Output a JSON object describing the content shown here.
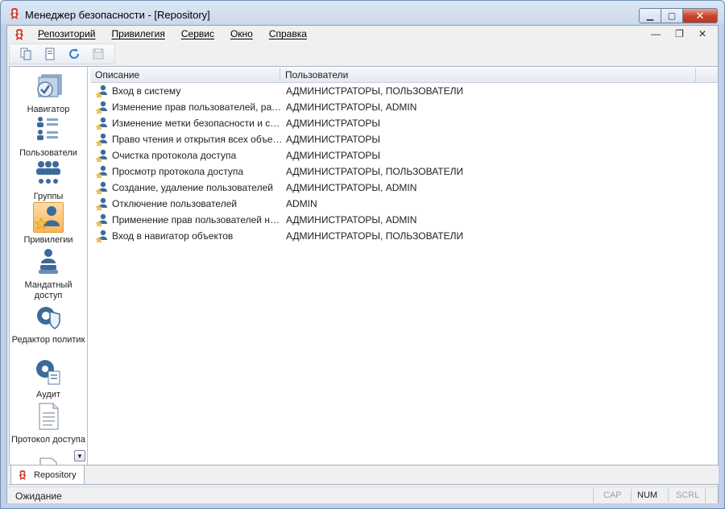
{
  "window": {
    "title": "Менеджер безопасности - [Repository]",
    "buttons": {
      "minimize": "▁",
      "maximize": "▢",
      "close": "✕"
    }
  },
  "menu": {
    "items": [
      "Репозиторий",
      "Привилегия",
      "Сервис",
      "Окно",
      "Справка"
    ],
    "mdi": {
      "minimize": "—",
      "restore": "❐",
      "close": "✕"
    }
  },
  "toolbar": {
    "buttons": [
      "copy-icon",
      "document-icon",
      "refresh-icon",
      "save-icon"
    ]
  },
  "nav": {
    "items": [
      {
        "label": "Навигатор",
        "icon": "navigator-icon",
        "active": false
      },
      {
        "label": "Пользователи",
        "icon": "users-list-icon",
        "active": false
      },
      {
        "label": "Группы",
        "icon": "groups-icon",
        "active": false
      },
      {
        "label": "Привилегии",
        "icon": "privileges-icon",
        "active": true
      },
      {
        "label": "Мандатный доступ",
        "icon": "mandatory-access-icon",
        "active": false
      },
      {
        "label": "Редактор политик",
        "icon": "policy-editor-icon",
        "active": false
      },
      {
        "label": "Аудит",
        "icon": "audit-icon",
        "active": false
      },
      {
        "label": "Протокол доступа",
        "icon": "access-log-icon",
        "active": false
      }
    ],
    "scroll_glyph": "▼"
  },
  "grid": {
    "columns": [
      "Описание",
      "Пользователи"
    ],
    "rows": [
      {
        "desc": "Вход в систему",
        "users": "АДМИНИСТРАТОРЫ, ПОЛЬЗОВАТЕЛИ"
      },
      {
        "desc": "Изменение прав пользователей, разд...",
        "users": "АДМИНИСТРАТОРЫ, ADMIN"
      },
      {
        "desc": "Изменение метки безопасности и спис...",
        "users": "АДМИНИСТРАТОРЫ"
      },
      {
        "desc": "Право чтения и открытия всех объек...",
        "users": "АДМИНИСТРАТОРЫ"
      },
      {
        "desc": "Очистка протокола доступа",
        "users": "АДМИНИСТРАТОРЫ"
      },
      {
        "desc": "Просмотр протокола доступа",
        "users": "АДМИНИСТРАТОРЫ, ПОЛЬЗОВАТЕЛИ"
      },
      {
        "desc": "Создание, удаление пользователей",
        "users": "АДМИНИСТРАТОРЫ, ADMIN"
      },
      {
        "desc": "Отключение пользователей",
        "users": "ADMIN"
      },
      {
        "desc": "Применение прав пользователей на у...",
        "users": "АДМИНИСТРАТОРЫ, ADMIN"
      },
      {
        "desc": "Вход в навигатор объектов",
        "users": "АДМИНИСТРАТОРЫ, ПОЛЬЗОВАТЕЛИ"
      }
    ]
  },
  "tabs": [
    {
      "label": "Repository"
    }
  ],
  "status": {
    "text": "Ожидание",
    "indicators": [
      {
        "label": "CAP",
        "on": false
      },
      {
        "label": "NUM",
        "on": true
      },
      {
        "label": "SCRL",
        "on": false
      }
    ]
  },
  "colors": {
    "active_nav": "#f7b655",
    "title_close": "#c9462c",
    "app_icon": "#d23b2a"
  }
}
